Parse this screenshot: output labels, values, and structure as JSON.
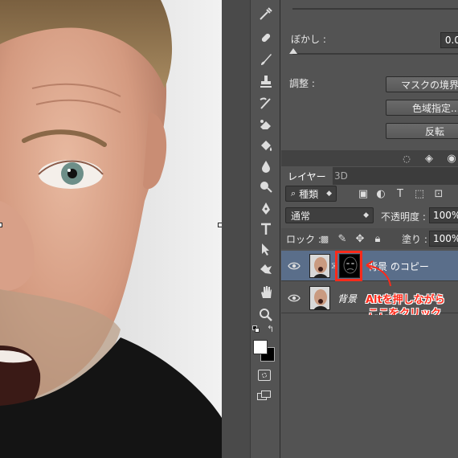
{
  "properties": {
    "blur_label": "ぼかし :",
    "blur_value": "0.0",
    "adjust_label": "調整 :",
    "mask_edge_button": "マスクの境界線",
    "color_range_button": "色域指定...",
    "invert_button": "反転"
  },
  "layers_panel": {
    "tab_layers": "レイヤー",
    "tab_3d": "3D",
    "filter_kind": "種類",
    "blend_mode": "通常",
    "opacity_label": "不透明度 :",
    "opacity_value": "100%",
    "lock_label": "ロック :",
    "fill_label": "塗り :",
    "fill_value": "100%",
    "layers": [
      {
        "name": "背景 のコピー",
        "visible": true,
        "selected": true,
        "has_mask": true
      },
      {
        "name": "背景",
        "visible": true,
        "selected": false,
        "has_mask": false
      }
    ]
  },
  "annotation": {
    "line1": "Altを押しながら",
    "line2": "ここをクリック",
    "color": "#ff2a1a"
  },
  "tools": [
    "eyedropper-icon",
    "healing-brush-icon",
    "brush-icon",
    "stamp-icon",
    "history-brush-icon",
    "eraser-icon",
    "paint-bucket-icon",
    "blur-icon",
    "dodge-icon",
    "pen-icon",
    "type-icon",
    "path-selection-icon",
    "shape-icon",
    "hand-icon",
    "zoom-icon"
  ],
  "colors": {
    "panel_bg": "#535353",
    "selected_layer": "#5a6e8a",
    "highlight_box": "#ff2a1a"
  }
}
